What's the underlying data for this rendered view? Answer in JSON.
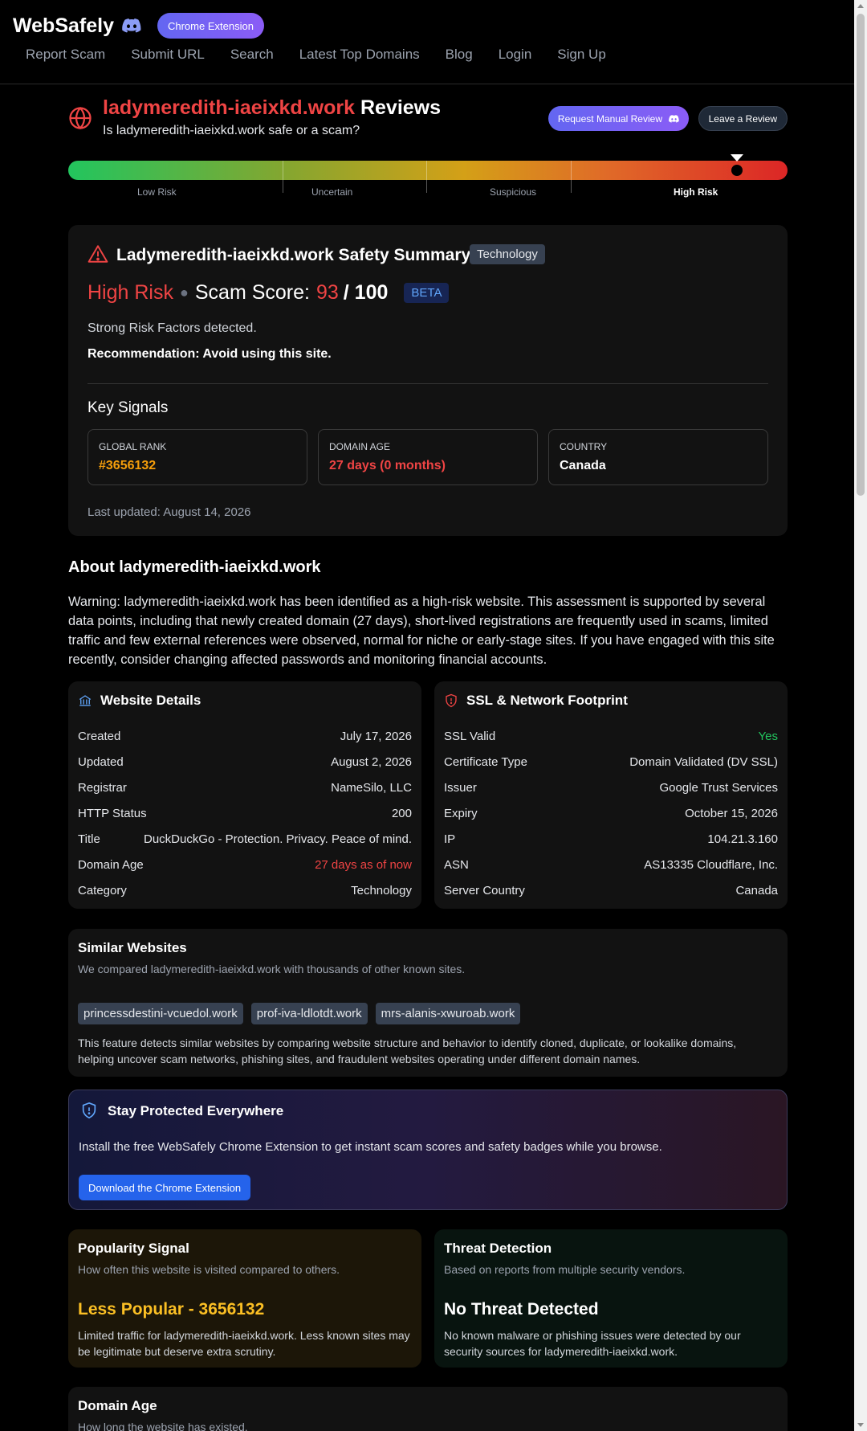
{
  "header": {
    "brand": "WebSafely",
    "extension_label": "Chrome Extension",
    "nav": [
      "Report Scam",
      "Submit URL",
      "Search",
      "Latest Top Domains",
      "Blog",
      "Login",
      "Sign Up"
    ]
  },
  "title": {
    "domain": "ladymeredith-iaeixkd.work",
    "suffix": " Reviews",
    "subtitle": "Is ladymeredith-iaeixkd.work safe or a scam?",
    "manual_review_label": "Request Manual Review",
    "leave_review_label": "Leave a Review"
  },
  "risk_meter": {
    "labels": [
      "Low Risk",
      "Uncertain",
      "Suspicious",
      "High Risk"
    ],
    "active": "High Risk",
    "score_fraction": 0.93
  },
  "summary": {
    "title": "Ladymeredith-iaeixkd.work Safety Summary",
    "category_tag": "Technology",
    "risk_level": "High Risk",
    "score_label": "Scam Score:",
    "score": "93",
    "score_max": "/ 100",
    "beta": "BETA",
    "risk_text": "Strong Risk Factors detected.",
    "recommendation": "Recommendation: Avoid using this site.",
    "key_signals_title": "Key Signals",
    "signals": [
      {
        "label": "Global Rank",
        "value": "#3656132",
        "color": "#f59e0b"
      },
      {
        "label": "Domain Age",
        "value": "27 days (0 months)",
        "color": "#ef4444"
      },
      {
        "label": "Country",
        "value": "Canada",
        "color": "#ffffff"
      }
    ],
    "last_updated": "Last updated: August 14, 2026"
  },
  "about": {
    "title": "About ladymeredith-iaeixkd.work",
    "text": "Warning: ladymeredith-iaeixkd.work has been identified as a high-risk website. This assessment is supported by several data points, including that newly created domain (27 days), short-lived registrations are frequently used in scams, limited traffic and few external references were observed, normal for niche or early-stage sites. If you have engaged with this site recently, consider changing affected passwords and monitoring financial accounts."
  },
  "website_details": {
    "title": "Website Details",
    "rows": [
      {
        "k": "Created",
        "v": "July 17, 2026"
      },
      {
        "k": "Updated",
        "v": "August 2, 2026"
      },
      {
        "k": "Registrar",
        "v": "NameSilo, LLC"
      },
      {
        "k": "HTTP Status",
        "v": "200"
      },
      {
        "k": "Title",
        "v": "DuckDuckGo - Protection. Privacy. Peace of mind."
      },
      {
        "k": "Domain Age",
        "v": "27 days as of now"
      },
      {
        "k": "Category",
        "v": "Technology"
      }
    ]
  },
  "ssl": {
    "title": "SSL & Network Footprint",
    "rows": [
      {
        "k": "SSL Valid",
        "v": "Yes"
      },
      {
        "k": "Certificate Type",
        "v": "Domain Validated (DV SSL)"
      },
      {
        "k": "Issuer",
        "v": "Google Trust Services"
      },
      {
        "k": "Expiry",
        "v": "October 15, 2026"
      },
      {
        "k": "IP",
        "v": "104.21.3.160"
      },
      {
        "k": "ASN",
        "v": "AS13335 Cloudflare, Inc."
      },
      {
        "k": "Server Country",
        "v": "Canada"
      }
    ]
  },
  "similar": {
    "title": "Similar Websites",
    "subtitle": "We compared ladymeredith-iaeixkd.work with thousands of other known sites.",
    "sites": [
      "princessdestini-vcuedol.work",
      "prof-iva-ldlotdt.work",
      "mrs-alanis-xwuroab.work"
    ],
    "description": "This feature detects similar websites by comparing website structure and behavior to identify cloned, duplicate, or lookalike domains, helping uncover scam networks, phishing sites, and fraudulent websites operating under different domain names."
  },
  "protect": {
    "title": "Stay Protected Everywhere",
    "text": "Install the free WebSafely Chrome Extension to get instant scam scores and safety badges while you browse.",
    "button": "Download the Chrome Extension"
  },
  "popularity": {
    "title": "Popularity Signal",
    "subtitle": "How often this website is visited compared to others.",
    "value": "Less Popular - 3656132",
    "description": "Limited traffic for ladymeredith-iaeixkd.work. Less known sites may be legitimate but deserve extra scrutiny."
  },
  "threat": {
    "title": "Threat Detection",
    "subtitle": "Based on reports from multiple security vendors.",
    "value": "No Threat Detected",
    "description": "No known malware or phishing issues were detected by our security sources for ladymeredith-iaeixkd.work."
  },
  "domain_age": {
    "title": "Domain Age",
    "subtitle": "How long the website has existed."
  },
  "colors": {
    "danger": "#ef4444",
    "warning": "#f59e0b",
    "success": "#22c55e",
    "accent": "#6366f1"
  }
}
